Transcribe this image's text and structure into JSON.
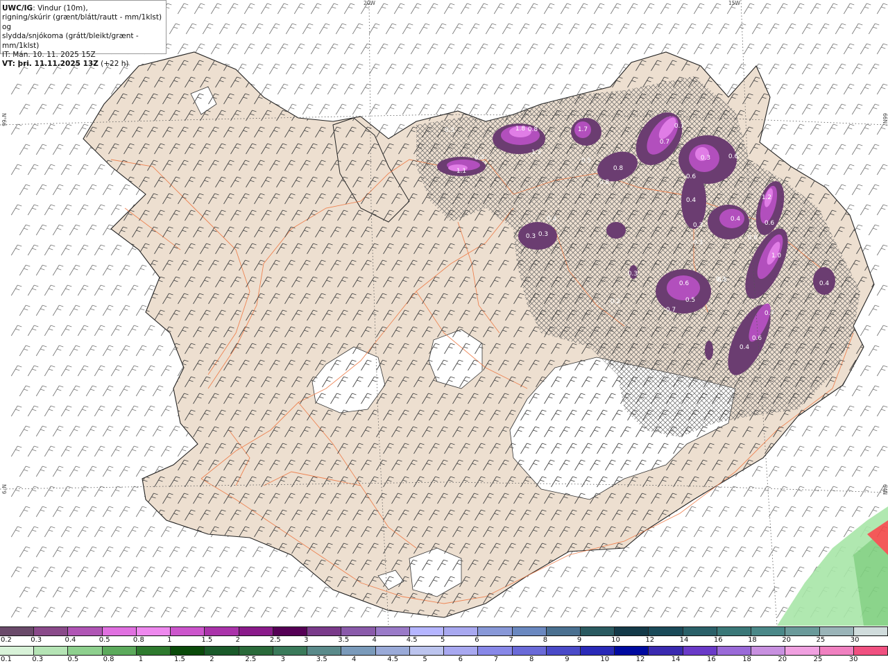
{
  "header": {
    "brand": "UWC/IG",
    "line1_rest": ": Vindur (10m),",
    "line2": "rigning/skúrir (grænt/blátt/rautt - mm/1klst) og",
    "line3": "slydda/snjókoma (grátt/bleikt/grænt - mm/1klst)",
    "line4": "IT: Mán. 10. 11. 2025 15Z",
    "line5_bold": "VT: þri. 11.11.2025 13Z",
    "line5_rest": " (+22 h)"
  },
  "grid_labels": {
    "top_left": "20W",
    "top_right": "15W",
    "left_upper": "N°66",
    "left_lower": "N°9",
    "right_upper": "66N",
    "right_lower": "64N"
  },
  "map_labels": [
    "0.3",
    "1.8",
    "0.8",
    "1.5",
    "1.7",
    "1.1",
    "0.3",
    "0.5",
    "0.3",
    "0.3",
    "0.4",
    "0.7",
    "0.7",
    "0.8",
    "0.8",
    "0.3",
    "0.6",
    "0.4",
    "0.6",
    "0.4",
    "1.2",
    "0.3",
    "0.6",
    "0.3",
    "0.6",
    "1.0",
    "0.3",
    "0.6",
    "0.5",
    "0.7",
    "0.3",
    "0.2",
    "0.4",
    "0.7",
    "0.6",
    "0.4",
    "0.3"
  ],
  "colors": {
    "land": "#eddfd0",
    "roads": "#ee7a45",
    "sea": "#ffffff",
    "glacier": "#ffffff",
    "precip_dark": "#6b3d71",
    "precip_mid": "#9b4aa6",
    "precip_light": "#d86be0",
    "rain_green": "#a8e6a8"
  },
  "scale_snow": {
    "labels": [
      "0.2",
      "0.3",
      "0.4",
      "0.5",
      "0.8",
      "1",
      "1.5",
      "2",
      "2.5",
      "3",
      "3.5",
      "4",
      "4.5",
      "5",
      "6",
      "7",
      "8",
      "9",
      "10",
      "12",
      "14",
      "16",
      "18",
      "20",
      "25",
      "30"
    ],
    "colors": [
      "#6a4a6a",
      "#8a4a8a",
      "#b055b5",
      "#e070e0",
      "#ee88ee",
      "#cc55cc",
      "#aa33aa",
      "#8a1a8a",
      "#550055",
      "#7a3a8a",
      "#8a5aaa",
      "#9a7ac8",
      "#b5b5ff",
      "#a8a8f0",
      "#8898d8",
      "#6a88c0",
      "#4a7090",
      "#2a5a60",
      "#143a48",
      "#1a4a58",
      "#2a6068",
      "#3a7878",
      "#4a8888",
      "#6a9a9a",
      "#9ab4b8",
      "#d0dcdc"
    ]
  },
  "scale_rain": {
    "labels": [
      "0.1",
      "0.3",
      "0.5",
      "0.8",
      "1",
      "1.5",
      "2",
      "2.5",
      "3",
      "3.5",
      "4",
      "4.5",
      "5",
      "6",
      "7",
      "8",
      "9",
      "10",
      "12",
      "14",
      "16",
      "18",
      "20",
      "25",
      "30"
    ],
    "colors": [
      "#d8f2d8",
      "#b5e4b5",
      "#8ed08e",
      "#5caa5c",
      "#2e7a2e",
      "#0a4a0a",
      "#1a5a2a",
      "#2a6a3a",
      "#3a7a5a",
      "#5a8a8a",
      "#7a9aba",
      "#9aaad8",
      "#bcc4ee",
      "#a8a8f0",
      "#8888e8",
      "#6a6ad8",
      "#4a4ac8",
      "#2a2ab8",
      "#000aa0",
      "#3a2ab0",
      "#6a3ac8",
      "#9a6ad8",
      "#c890e0",
      "#f0a0e0",
      "#f080c0",
      "#f05080",
      "#e02020"
    ]
  }
}
